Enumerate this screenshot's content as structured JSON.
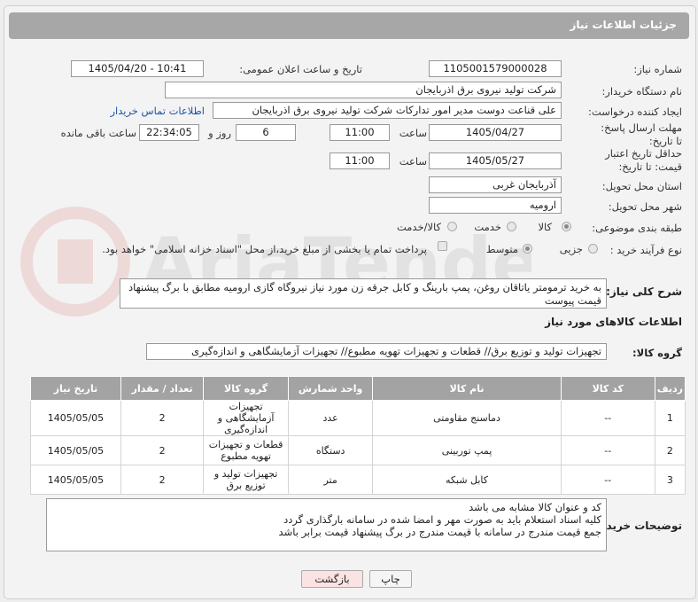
{
  "header": {
    "title": "جزئیات اطلاعات نیاز"
  },
  "fields": {
    "need_number": {
      "label": "شماره نیاز:",
      "value": "1105001579000028"
    },
    "announce_datetime": {
      "label": "تاریخ و ساعت اعلان عمومی:",
      "value": "1405/04/20 - 10:41"
    },
    "buyer_org": {
      "label": "نام دستگاه خریدار:",
      "value": "شرکت تولید نیروی برق اذربایجان"
    },
    "requester": {
      "label": "ایجاد کننده درخواست:",
      "value": "علی قناعت دوست مدیر امور تدارکات شرکت تولید نیروی برق اذربایجان",
      "link": "اطلاعات تماس خریدار"
    },
    "reply_deadline": {
      "label": "مهلت ارسال پاسخ: تا تاریخ:",
      "date": "1405/04/27",
      "time_label": "ساعت",
      "time": "11:00",
      "days": "6",
      "days_label": "روز و",
      "remaining": "22:34:05",
      "remaining_label": "ساعت باقی مانده"
    },
    "price_validity": {
      "label": "حداقل تاریخ اعتبار قیمت: تا تاریخ:",
      "date": "1405/05/27",
      "time_label": "ساعت",
      "time": "11:00"
    },
    "delivery_province": {
      "label": "استان محل تحویل:",
      "value": "آذربایجان غربی"
    },
    "delivery_city": {
      "label": "شهر محل تحویل:",
      "value": "ارومیه"
    },
    "category": {
      "label": "طبقه بندی موضوعی:",
      "options": [
        "کالا",
        "خدمت",
        "کالا/خدمت"
      ]
    },
    "process_type": {
      "label": "نوع فرآیند خرید :",
      "options": [
        "جزیی",
        "متوسط"
      ],
      "payment_note": "پرداخت تمام یا بخشی از مبلغ خرید،از محل \"اسناد خزانه اسلامی\" خواهد بود."
    }
  },
  "description": {
    "label": "شرح کلی نیاز:",
    "text": "به خرید ترمومتر یاتاقان روغن، پمپ بارینگ و کابل       جرقه زن مورد نیاز نیروگاه گازی ارومیه مطابق با برگ پیشنهاد قیمت پیوست"
  },
  "goods_section": {
    "title": "اطلاعات کالاهای مورد نیاز",
    "group_label": "گروه کالا:",
    "group_value": "تجهیزات تولید و توزیع برق//  قطعات و تجهیزات تهویه مطبوع// تجهیزات آزمایشگاهی و اندازه‌گیری"
  },
  "table": {
    "headers": [
      "ردیف",
      "کد کالا",
      "نام کالا",
      "واحد شمارش",
      "گروه کالا",
      "تعداد / مقدار",
      "تاریخ نیاز"
    ],
    "rows": [
      [
        "1",
        "--",
        "دماسنج مقاومتی",
        "عدد",
        "تجهیزات آزمایشگاهی و اندازه‌گیری",
        "2",
        "1405/05/05"
      ],
      [
        "2",
        "--",
        "پمپ توربینی",
        "دستگاه",
        "قطعات و تجهیزات تهویه مطبوع",
        "2",
        "1405/05/05"
      ],
      [
        "3",
        "--",
        "کابل شبکه",
        "متر",
        "تجهیزات تولید و توزیع برق",
        "2",
        "1405/05/05"
      ]
    ]
  },
  "buyer_notes": {
    "label": "توضیحات خریدار:",
    "lines": [
      "کد و عنوان کالا مشابه می باشد",
      "کلیه اسناد استعلام باید به صورت مهر و امضا شده در سامانه بارگذاری گردد",
      "جمع قیمت مندرج در سامانه با قیمت مندرج در برگ پیشنهاد قیمت برابر باشد"
    ]
  },
  "buttons": {
    "print": "چاپ",
    "back": "بازگشت"
  },
  "colors": {
    "header_bg": "#a7a7a7",
    "link": "#1a55a8",
    "back_button_bg": "#fbe3e3"
  }
}
